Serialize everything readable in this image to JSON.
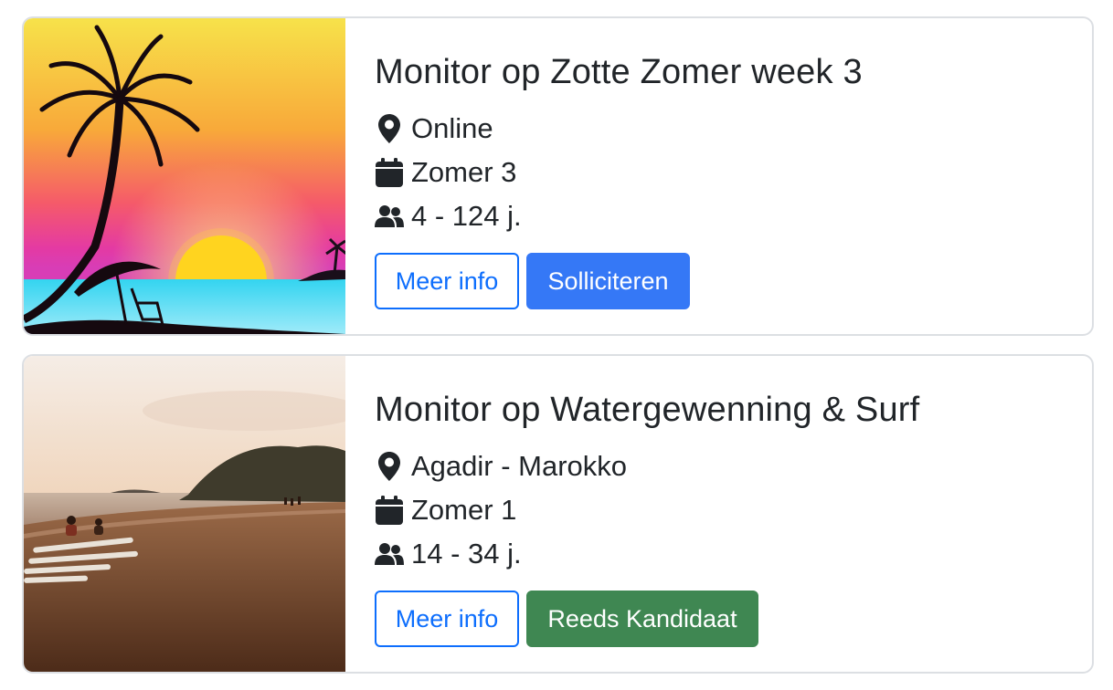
{
  "cards": [
    {
      "title": "Monitor op Zotte Zomer week 3",
      "location": "Online",
      "period": "Zomer 3",
      "ages": "4 - 124 j.",
      "info_label": "Meer info",
      "action_label": "Solliciteren",
      "action_color": "#3578f6",
      "image": "tropical-sunset-palm-illustration"
    },
    {
      "title": "Monitor op Watergewenning & Surf",
      "location": "Agadir - Marokko",
      "period": "Zomer 1",
      "ages": "14 - 34 j.",
      "info_label": "Meer info",
      "action_label": "Reeds Kandidaat",
      "action_color": "#3f8752",
      "image": "beach-surf-photo"
    }
  ],
  "icons": {
    "location": "map-pin-icon",
    "period": "calendar-icon",
    "ages": "people-icon"
  },
  "colors": {
    "primary": "#0d6efd",
    "success": "#3f8752",
    "border": "#dcdfe3"
  }
}
